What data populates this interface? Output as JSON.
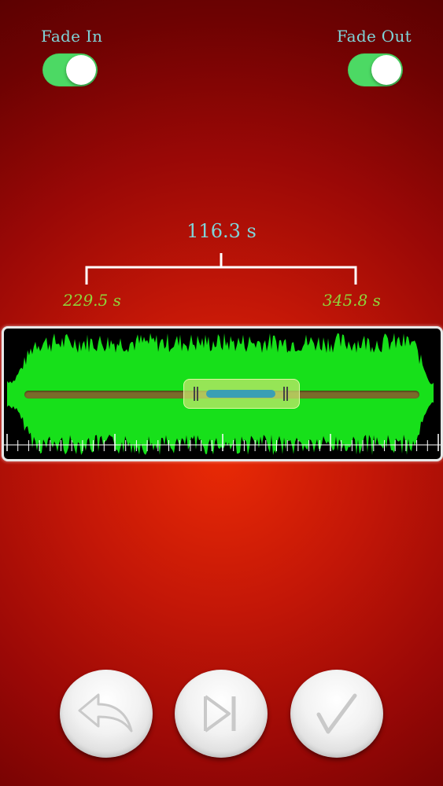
{
  "toggles": {
    "fade_in": {
      "label": "Fade In",
      "on": true
    },
    "fade_out": {
      "label": "Fade Out",
      "on": true
    }
  },
  "selection": {
    "duration": "116.3 s",
    "start": "229.5 s",
    "end": "345.8 s"
  },
  "colors": {
    "label_cyan": "#7fd4d8",
    "time_green": "#8fd43a",
    "switch_on": "#4cd964",
    "waveform": "#17e01a",
    "selection": "#c8e66e"
  },
  "controls": [
    {
      "icon": "back-arrow-icon"
    },
    {
      "icon": "play-next-icon"
    },
    {
      "icon": "checkmark-icon"
    }
  ]
}
